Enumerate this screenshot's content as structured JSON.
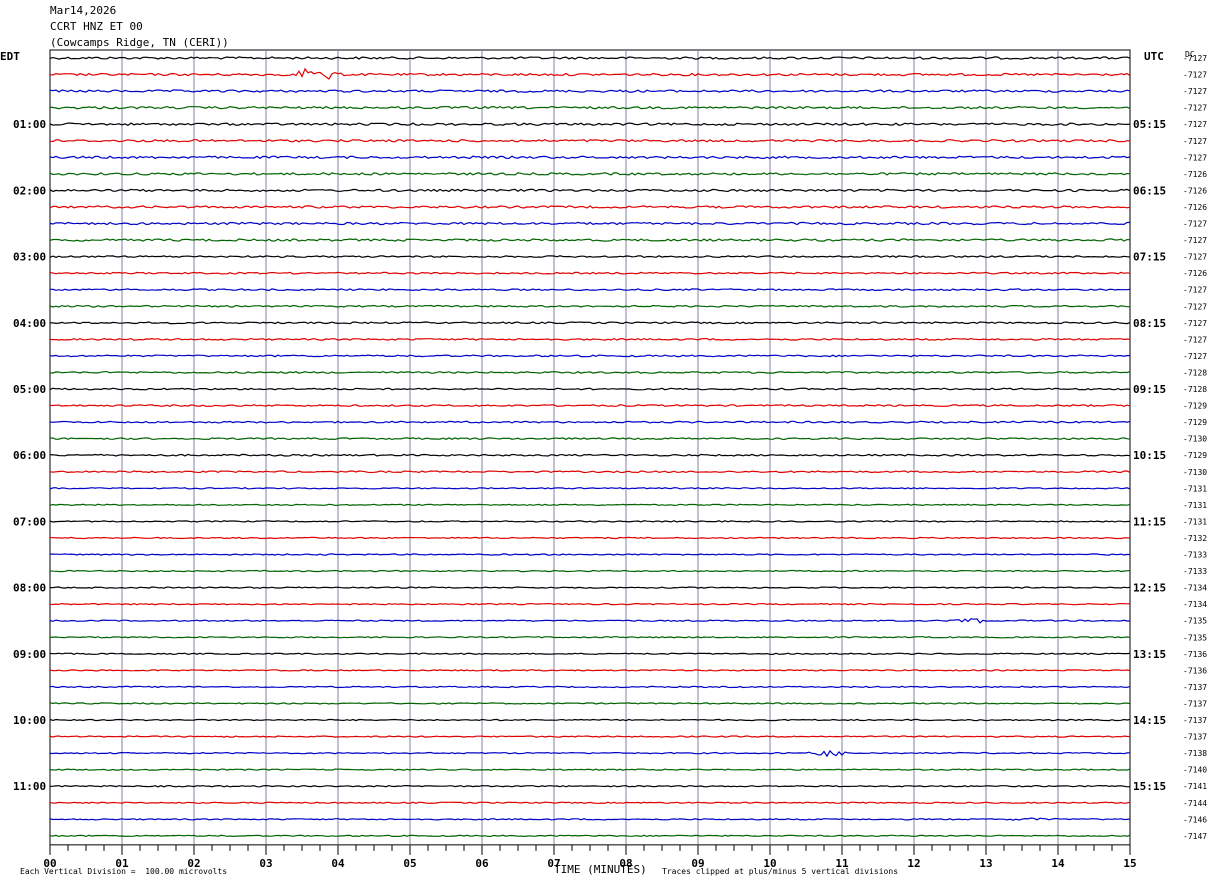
{
  "header": {
    "date": "Mar14,2026",
    "channel": "CCRT HNZ ET 00",
    "station": "(Cowcamps Ridge, TN (CERI))"
  },
  "labels": {
    "left_tz": "EDT",
    "right_tz": "UTC",
    "dc": "DC",
    "footer_left": "Each Vertical Division =  100.00 microvolts",
    "footer_right": "Traces clipped at plus/minus 5 vertical divisions"
  },
  "chart_data": {
    "type": "line",
    "title": "CCRT HNZ ET 00",
    "xlabel": "TIME (MINUTES)",
    "x_tick_labels": [
      "00",
      "01",
      "02",
      "03",
      "04",
      "05",
      "06",
      "07",
      "08",
      "09",
      "10",
      "11",
      "12",
      "13",
      "14",
      "15"
    ],
    "xlim": [
      0,
      15
    ],
    "line_colors": [
      "#000000",
      "#e00000",
      "#0000c8",
      "#006400"
    ],
    "left_time_labels": [
      "01:00",
      "02:00",
      "03:00",
      "04:00",
      "05:00",
      "06:00",
      "07:00",
      "08:00",
      "09:00",
      "10:00",
      "11:00"
    ],
    "right_time_labels": [
      "05:15",
      "06:15",
      "07:15",
      "08:15",
      "09:15",
      "10:15",
      "11:15",
      "12:15",
      "13:15",
      "14:15",
      "15:15"
    ],
    "dc_offsets": [
      "-7127",
      "-7127",
      "-7127",
      "-7127",
      "-7127",
      "-7127",
      "-7127",
      "-7126",
      "-7126",
      "-7126",
      "-7127",
      "-7127",
      "-7127",
      "-7126",
      "-7127",
      "-7127",
      "-7127",
      "-7127",
      "-7127",
      "-7128",
      "-7128",
      "-7129",
      "-7129",
      "-7130",
      "-7129",
      "-7130",
      "-7131",
      "-7131",
      "-7131",
      "-7132",
      "-7133",
      "-7133",
      "-7134",
      "-7134",
      "-7135",
      "-7135",
      "-7136",
      "-7136",
      "-7137",
      "-7137",
      "-7137",
      "-7137",
      "-7138",
      "-7140",
      "-7141",
      "-7144",
      "-7146",
      "-7147"
    ],
    "events": [
      {
        "trace": 1,
        "minute": 3.7,
        "amplitude": 8
      },
      {
        "trace": 34,
        "minute": 12.8,
        "amplitude": 3
      },
      {
        "trace": 42,
        "minute": 10.8,
        "amplitude": 3
      },
      {
        "trace": 46,
        "minute": 13.6,
        "amplitude": 2
      }
    ]
  }
}
